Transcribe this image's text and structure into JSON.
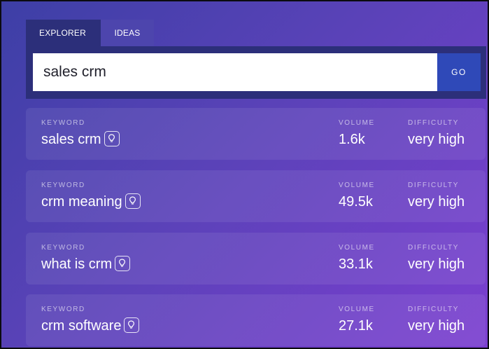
{
  "tabs": [
    {
      "label": "EXPLORER",
      "active": true
    },
    {
      "label": "IDEAS",
      "active": false
    }
  ],
  "search": {
    "value": "sales crm",
    "button_label": "GO"
  },
  "column_labels": {
    "keyword": "KEYWORD",
    "volume": "VOLUME",
    "difficulty": "DIFFICULTY"
  },
  "rows": [
    {
      "keyword": "sales crm",
      "volume": "1.6k",
      "difficulty": "very high"
    },
    {
      "keyword": "crm meaning",
      "volume": "49.5k",
      "difficulty": "very high"
    },
    {
      "keyword": "what is crm",
      "volume": "33.1k",
      "difficulty": "very high"
    },
    {
      "keyword": "crm software",
      "volume": "27.1k",
      "difficulty": "very high"
    }
  ],
  "icons": {
    "ideas_button": "lightbulb-icon"
  },
  "colors": {
    "accent_go": "#2f49b8",
    "panel_dark": "#2c2f7a"
  }
}
